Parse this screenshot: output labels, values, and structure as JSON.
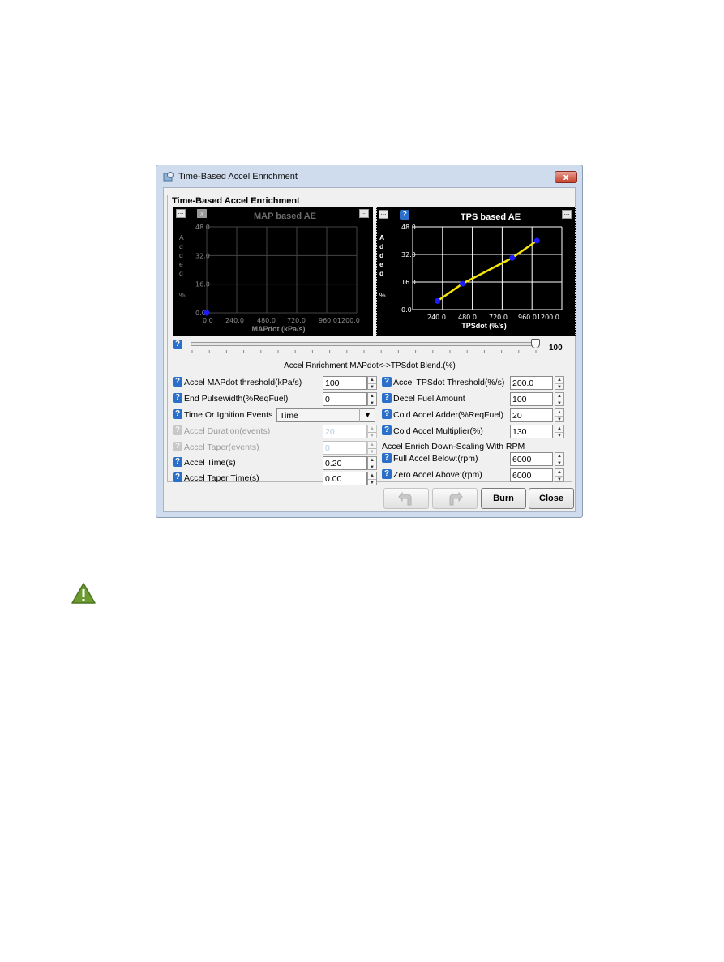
{
  "window": {
    "title": "Time-Based Accel Enrichment",
    "close_glyph": "x",
    "group_title": "Time-Based Accel Enrichment"
  },
  "map_chart": {
    "title": "MAP based AE",
    "ylabel": "Added\n%",
    "xlabel": "MAPdot (kPa/s)",
    "y_ticks": [
      "48.0",
      "32.0",
      "16.0",
      "0.0"
    ],
    "x_ticks": [
      "0.0",
      "240.0",
      "480.0",
      "720.0",
      "960.01200.0"
    ],
    "menu_glyph": "...",
    "close_glyph": "x"
  },
  "tps_chart": {
    "title": "TPS based AE",
    "ylabel": "Added\n%",
    "xlabel": "TPSdot (%/s)",
    "y_ticks": [
      "48.0",
      "32.0",
      "16.0",
      "0.0"
    ],
    "x_ticks": [
      "240.0",
      "480.0",
      "720.0",
      "960.01200.0"
    ],
    "menu_glyph": "...",
    "help_glyph": "?"
  },
  "chart_data": [
    {
      "type": "line",
      "title": "MAP based AE",
      "xlabel": "MAPdot (kPa/s)",
      "ylabel": "Added %",
      "xlim": [
        0,
        1200
      ],
      "ylim": [
        0,
        48
      ],
      "x": [
        0
      ],
      "y": [
        0
      ],
      "grid": true
    },
    {
      "type": "line",
      "title": "TPS based AE",
      "xlabel": "TPSdot (%/s)",
      "ylabel": "Added %",
      "xlim": [
        0,
        1200
      ],
      "ylim": [
        0,
        48
      ],
      "x": [
        200,
        400,
        800,
        1000
      ],
      "y": [
        5,
        15,
        30,
        40
      ],
      "line_color": "#f5e50a",
      "point_color": "#1b1bff",
      "grid": true
    }
  ],
  "slider": {
    "value": "100",
    "fraction": 1.0,
    "label": "Accel Rnrichment MAPdot<->TPSdot Blend.(%)"
  },
  "left_fields": [
    {
      "label": "Accel MAPdot threshold(kPa/s)",
      "value": "100",
      "enabled": true
    },
    {
      "label": "End Pulsewidth(%ReqFuel)",
      "value": "0",
      "enabled": true
    },
    {
      "label": "Time Or Ignition Events",
      "value": "Time",
      "enabled": true
    },
    {
      "label": "Accel Duration(events)",
      "value": "20",
      "enabled": false
    },
    {
      "label": "Accel Taper(events)",
      "value": "0",
      "enabled": false
    },
    {
      "label": "Accel Time(s)",
      "value": "0.20",
      "enabled": true
    },
    {
      "label": "Accel Taper Time(s)",
      "value": "0.00",
      "enabled": true
    }
  ],
  "right_fields": [
    {
      "label": "Accel TPSdot Threshold(%/s)",
      "value": "200.0"
    },
    {
      "label": "Decel Fuel Amount",
      "value": "100"
    },
    {
      "label": "Cold Accel Adder(%ReqFuel)",
      "value": "20"
    },
    {
      "label": "Cold Accel Multiplier(%)",
      "value": "130"
    },
    {
      "label": "Full Accel Below:(rpm)",
      "value": "6000"
    },
    {
      "label": "Zero Accel Above:(rpm)",
      "value": "6000"
    }
  ],
  "section_label": "Accel Enrich Down-Scaling With RPM",
  "buttons": {
    "undo": "undo-icon",
    "redo": "redo-icon",
    "burn": "Burn",
    "close": "Close"
  },
  "help_glyph": "?",
  "spin_up": "▲",
  "spin_down": "▼",
  "combo_arrow": "▼",
  "colors": {
    "warning_icon": "#6b9b2e",
    "help_icon": "#2a6fc9",
    "window_frame": "#cfdced"
  }
}
